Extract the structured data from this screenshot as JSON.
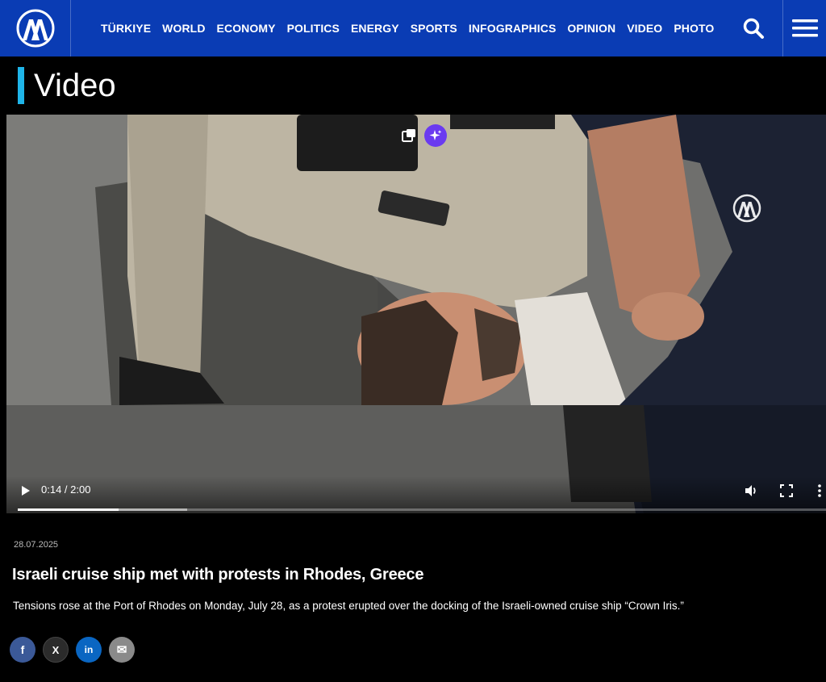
{
  "brand": {
    "logo_text": "AA",
    "color": "#0a3cb4"
  },
  "nav": {
    "items": [
      "TÜRKIYE",
      "WORLD",
      "ECONOMY",
      "POLITICS",
      "ENERGY",
      "SPORTS",
      "INFOGRAPHICS",
      "OPINION",
      "VIDEO",
      "PHOTO"
    ]
  },
  "header": {
    "search_icon": "search-icon",
    "menu_icon": "hamburger-menu-icon"
  },
  "section": {
    "title": "Video",
    "accent": "#1fb5e9"
  },
  "video": {
    "current_time": "0:14",
    "duration": "2:00",
    "time_label": "0:14 / 2:00",
    "progress": 0.125,
    "buffered": 0.21,
    "watermark": "AA"
  },
  "article": {
    "date": "28.07.2025",
    "headline": "Israeli cruise ship met with protests in Rhodes, Greece",
    "summary": "Tensions rose at the Port of Rhodes on Monday, July 28, as a protest erupted over the docking of the Israeli-owned cruise ship “Crown Iris.”"
  },
  "share": {
    "buttons": [
      {
        "name": "facebook",
        "glyph": "f",
        "color": "#3b5998"
      },
      {
        "name": "x",
        "glyph": "X",
        "color": "#2b2b2b"
      },
      {
        "name": "linkedin",
        "glyph": "in",
        "color": "#0a66c2"
      },
      {
        "name": "email",
        "glyph": "✉",
        "color": "#8a8a8a"
      }
    ]
  }
}
